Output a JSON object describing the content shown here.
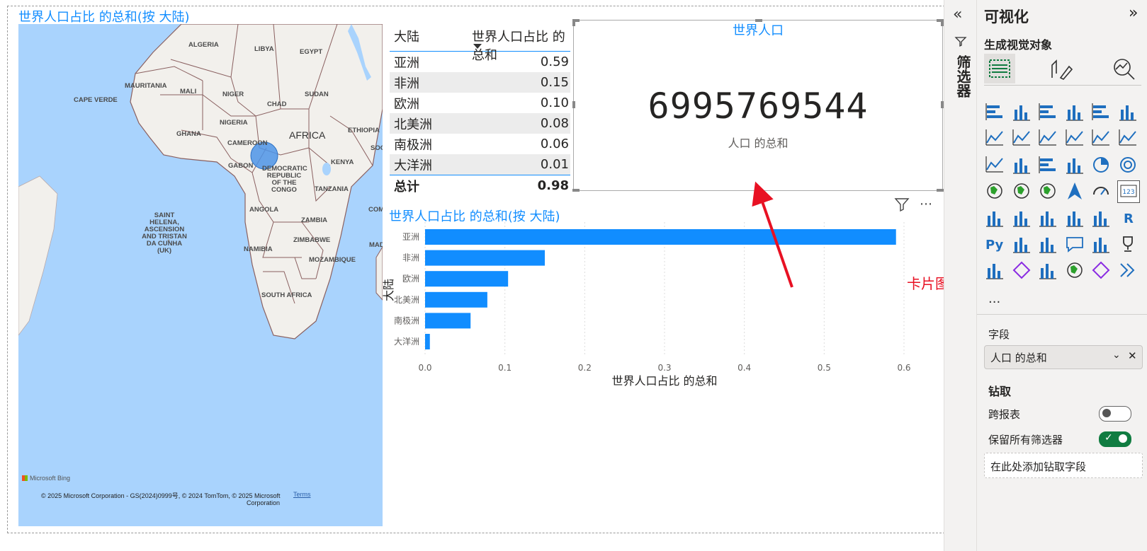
{
  "map": {
    "title": "世界人口占比 的总和(按 大陆)",
    "labels": {
      "algeria": "ALGERIA",
      "libya": "LIBYA",
      "egypt": "EGYPT",
      "mauritania": "MAURITANIA",
      "mali": "MALI",
      "niger": "NIGER",
      "sudan": "SUDAN",
      "chad": "CHAD",
      "cape_verde": "CAPE VERDE",
      "nigeria": "NIGERIA",
      "ghana": "GHANA",
      "africa": "AFRICA",
      "ethiopia": "ETHIOPIA",
      "cameroon": "CAMEROON",
      "somalia": "SOO",
      "gabon": "GABON",
      "drc": "DEMOCRATIC REPUBLIC OF THE CONGO",
      "kenya": "KENYA",
      "tanzania": "TANZANIA",
      "angola": "ANGOLA",
      "zambia": "ZAMBIA",
      "zimbabwe": "ZIMBABWE",
      "mada": "MADA",
      "namibia": "NAMIBIA",
      "mozambique": "MOZAMBIQUE",
      "south_africa": "SOUTH AFRICA",
      "comoros": "COMO",
      "saint_helena": "SAINT HELENA, ASCENSION AND TRISTAN DA CUNHA (UK)"
    },
    "bing": "Microsoft Bing",
    "copyright_line1": "© 2025 Microsoft Corporation - GS(2024)0999号, © 2024 TomTom, © 2025 Microsoft",
    "copyright_line2": "Corporation",
    "terms": "Terms"
  },
  "table": {
    "col1": "大陆",
    "col2": "世界人口占比 的总和",
    "rows": [
      {
        "name": "亚洲",
        "value": "0.59"
      },
      {
        "name": "非洲",
        "value": "0.15"
      },
      {
        "name": "欧洲",
        "value": "0.10"
      },
      {
        "name": "北美洲",
        "value": "0.08"
      },
      {
        "name": "南极洲",
        "value": "0.06"
      },
      {
        "name": "大洋洲",
        "value": "0.01"
      }
    ],
    "total_label": "总计",
    "total_value": "0.98"
  },
  "card": {
    "title": "世界人口",
    "value": "6995769544",
    "label": "人口 的总和"
  },
  "annotation": {
    "text": "卡片图",
    "color": "#e81123"
  },
  "chart_data": {
    "type": "bar",
    "orientation": "horizontal",
    "title": "世界人口占比 的总和(按 大陆)",
    "categories": [
      "亚洲",
      "非洲",
      "欧洲",
      "北美洲",
      "南极洲",
      "大洋洲"
    ],
    "values": [
      0.59,
      0.15,
      0.104,
      0.078,
      0.057,
      0.006
    ],
    "xlabel": "世界人口占比 的总和",
    "ylabel": "大陆",
    "xlim": [
      0,
      0.6
    ],
    "xticks": [
      "0.0",
      "0.1",
      "0.2",
      "0.3",
      "0.4",
      "0.5",
      "0.6"
    ],
    "grid": true,
    "color": "#118dff"
  },
  "filter_pane": {
    "label": "筛选器"
  },
  "viz_pane": {
    "title": "可视化",
    "subtitle": "生成视觉对象",
    "fields_label": "字段",
    "field_value": "人口 的总和",
    "drill_label": "钻取",
    "cross_report": "跨报表",
    "cross_report_on": false,
    "keep_filters": "保留所有筛选器",
    "keep_filters_on": true,
    "add_drill": "在此处添加钻取字段",
    "more": "...",
    "py": "Py",
    "r": "R",
    "card_icon_text": "123"
  }
}
